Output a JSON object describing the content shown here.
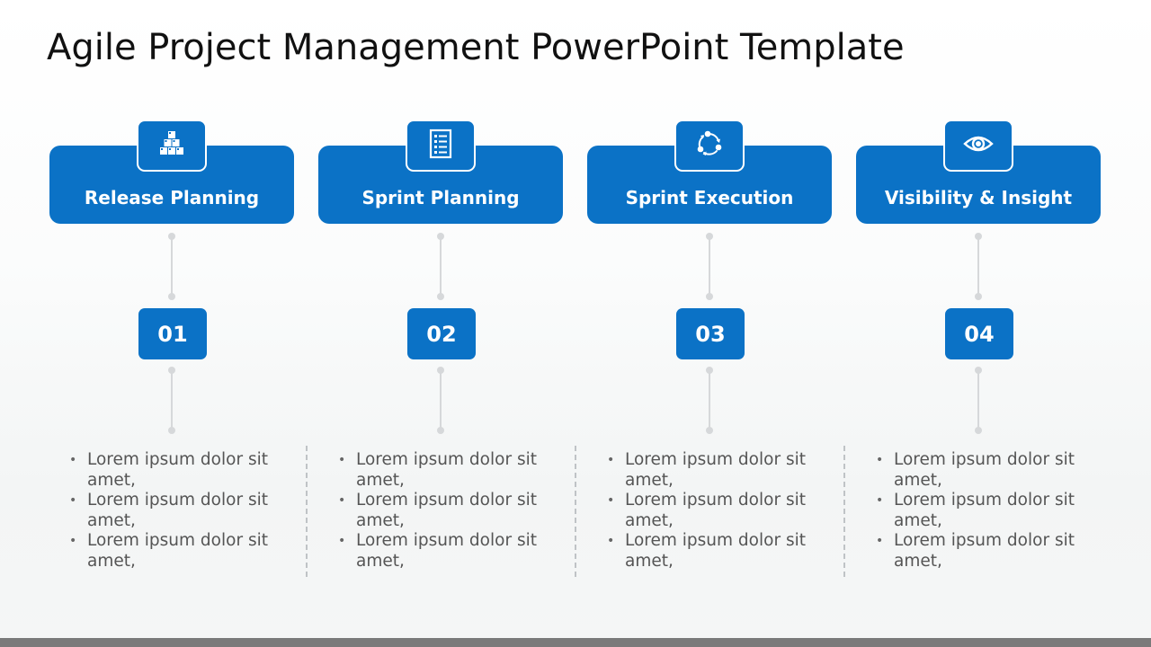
{
  "slide": {
    "title": "Agile Project Management PowerPoint Template"
  },
  "colors": {
    "accent": "#0b72c6",
    "connector": "#d6d8da",
    "text": "#555555",
    "footer": "#7a7a7a"
  },
  "columns": [
    {
      "icon": "boxes-pyramid-icon",
      "label": "Release Planning",
      "number": "01",
      "bullets": [
        "Lorem ipsum dolor sit amet,",
        "Lorem ipsum dolor sit amet,",
        "Lorem ipsum dolor sit amet,"
      ]
    },
    {
      "icon": "checklist-icon",
      "label": "Sprint Planning",
      "number": "02",
      "bullets": [
        "Lorem ipsum dolor sit amet,",
        "Lorem ipsum dolor sit amet,",
        "Lorem ipsum dolor sit amet,"
      ]
    },
    {
      "icon": "cycle-arrows-icon",
      "label": "Sprint Execution",
      "number": "03",
      "bullets": [
        "Lorem ipsum dolor sit amet,",
        "Lorem ipsum dolor sit amet,",
        "Lorem ipsum dolor sit amet,"
      ]
    },
    {
      "icon": "eye-icon",
      "label": "Visibility & Insight",
      "number": "04",
      "bullets": [
        "Lorem ipsum dolor sit amet,",
        "Lorem ipsum dolor sit amet,",
        "Lorem ipsum dolor sit amet,"
      ]
    }
  ]
}
